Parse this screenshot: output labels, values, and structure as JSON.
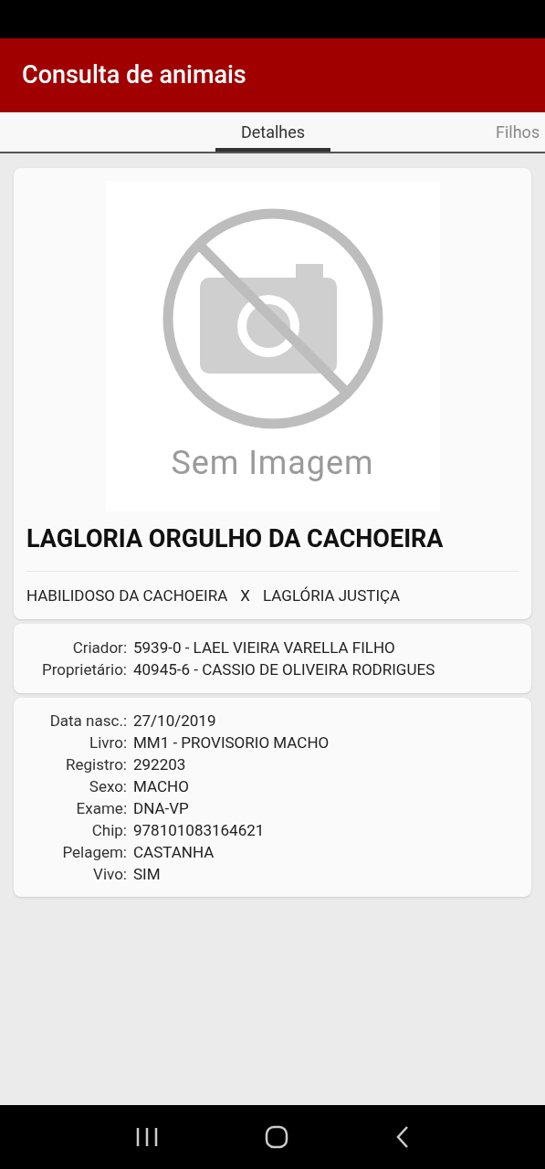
{
  "app_bar": {
    "title": "Consulta de animais"
  },
  "tabs": [
    {
      "label": "Detalhes",
      "selected": true
    },
    {
      "label": "Filhos",
      "selected": false
    }
  ],
  "animal": {
    "photo_placeholder": "Sem Imagem",
    "name": "LAGLORIA ORGULHO DA CACHOEIRA",
    "sire": "HABILIDOSO DA CACHOEIRA",
    "separator": "X",
    "dam": "LAGLÓRIA JUSTIÇA"
  },
  "ownership": [
    {
      "label": "Criador:",
      "value": "5939-0 - LAEL VIEIRA VARELLA FILHO"
    },
    {
      "label": "Proprietário:",
      "value": "40945-6 - CASSIO DE OLIVEIRA RODRIGUES"
    }
  ],
  "details": [
    {
      "label": "Data nasc.:",
      "value": "27/10/2019"
    },
    {
      "label": "Livro:",
      "value": "MM1 - PROVISORIO MACHO"
    },
    {
      "label": "Registro:",
      "value": "292203"
    },
    {
      "label": "Sexo:",
      "value": "MACHO"
    },
    {
      "label": "Exame:",
      "value": "DNA-VP"
    },
    {
      "label": "Chip:",
      "value": "978101083164621"
    },
    {
      "label": "Pelagem:",
      "value": "CASTANHA"
    },
    {
      "label": "Vivo:",
      "value": "SIM"
    }
  ]
}
